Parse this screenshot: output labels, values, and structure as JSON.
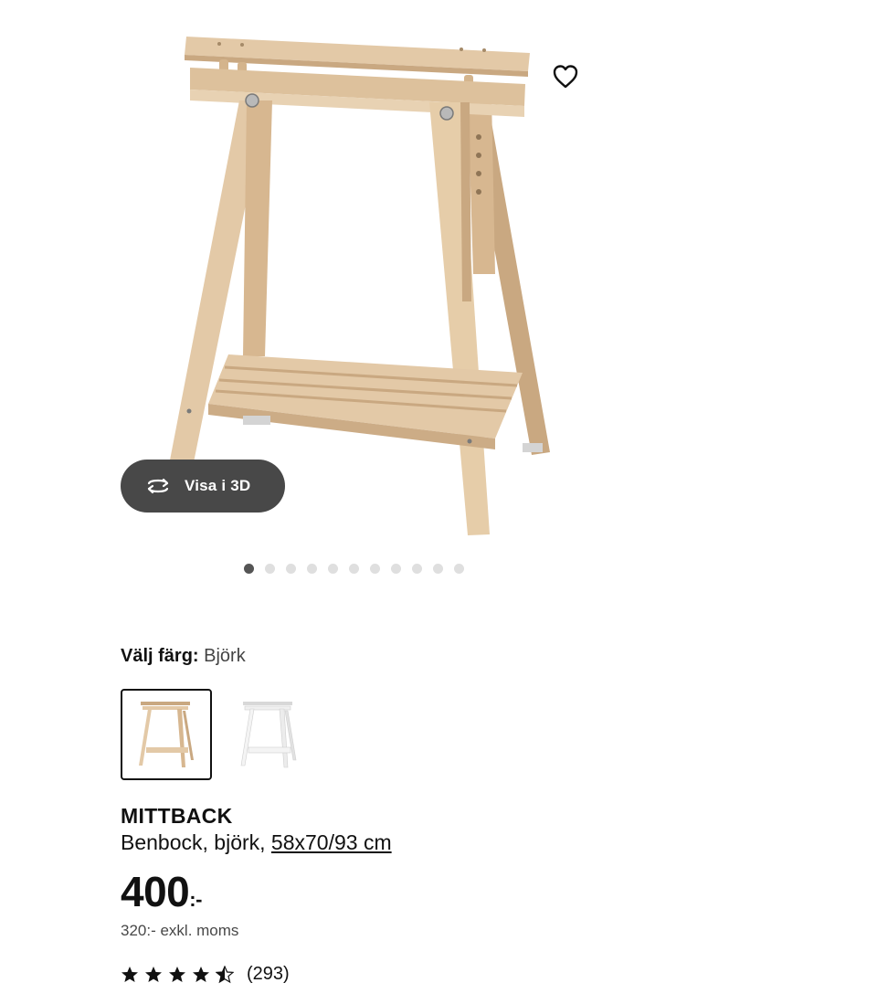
{
  "product": {
    "name": "MITTBACK",
    "description": "Benbock, björk, ",
    "size_link": "58x70/93 cm",
    "price": "400",
    "price_suffix": ":-",
    "price_excl_vat": "320:- exkl. moms",
    "review_count": "(293)",
    "rating": 4.5,
    "rating_max": 5
  },
  "gallery": {
    "view_3d_label": "Visa i 3D",
    "view_3d_icon": "rotate-3d-icon",
    "favourite_icon": "heart-icon",
    "image_count": 11,
    "current_index": 0
  },
  "color_picker": {
    "label": "Välj färg:",
    "selected": "Björk",
    "options": [
      "Björk",
      "Vit"
    ]
  },
  "colors": {
    "wood": "#e3c9a7",
    "wood_dark": "#c9a881",
    "white_variant": "#f4f4f4",
    "button_bg": "#484848",
    "dot_active": "#555555",
    "dot_inactive": "#dfdfdf"
  }
}
